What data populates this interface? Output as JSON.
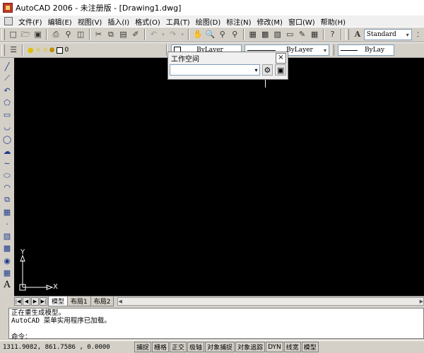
{
  "window": {
    "title": "AutoCAD 2006 - 未注册版 - [Drawing1.dwg]"
  },
  "menubar": {
    "items": [
      "文件(F)",
      "编辑(E)",
      "视图(V)",
      "插入(I)",
      "格式(O)",
      "工具(T)",
      "绘图(D)",
      "标注(N)",
      "修改(M)",
      "窗口(W)",
      "帮助(H)"
    ]
  },
  "toolbar1": {
    "icons": [
      "new-icon",
      "open-icon",
      "save-icon",
      "print-icon",
      "print-preview-icon",
      "publish-icon",
      "cut-icon",
      "copy-icon",
      "paste-icon",
      "match-properties-icon",
      "undo-icon",
      "redo-icon",
      "pan-icon",
      "zoom-realtime-icon",
      "zoom-window-icon",
      "zoom-previous-icon",
      "properties-icon",
      "design-center-icon",
      "tool-palettes-icon",
      "sheet-set-icon",
      "markup-icon",
      "calculator-icon",
      "help-icon"
    ],
    "text_style": "Standard"
  },
  "toolbar2": {
    "layer_icons": [
      "layers-icon",
      "light-bulb-icon",
      "sun-icon",
      "lock-icon",
      "color-square-icon"
    ],
    "layer_name": "0",
    "linetype": "ByLayer",
    "lineweight": "ByLay"
  },
  "workspace_panel": {
    "title": "工作空间",
    "close_label": "×",
    "selected": ""
  },
  "draw_toolbar": {
    "icons": [
      "line-icon",
      "construction-line-icon",
      "polyline-icon",
      "polygon-icon",
      "rectangle-icon",
      "arc-icon",
      "circle-icon",
      "revision-cloud-icon",
      "spline-icon",
      "ellipse-icon",
      "ellipse-arc-icon",
      "insert-block-icon",
      "make-block-icon",
      "point-icon",
      "hatch-icon",
      "gradient-icon",
      "region-icon",
      "table-icon",
      "multiline-text-icon"
    ]
  },
  "ucs": {
    "y_label": "Y",
    "x_label": "X"
  },
  "tabs": {
    "items": [
      {
        "label": "模型",
        "active": true
      },
      {
        "label": "布局1",
        "active": false
      },
      {
        "label": "布局2",
        "active": false
      }
    ]
  },
  "command": {
    "history": [
      "正在重生成模型。",
      "AutoCAD 菜单实用程序已加载。"
    ],
    "prompt": "命令："
  },
  "status": {
    "coords": "1311.9082, 861.7586 , 0.0000",
    "toggles": [
      "捕捉",
      "栅格",
      "正交",
      "极轴",
      "对象捕捉",
      "对象追踪",
      "DYN",
      "线宽",
      "模型"
    ]
  },
  "colors": {
    "canvas": "#000000",
    "chrome": "#d4d0c8",
    "menubar": "#f0f0f0"
  }
}
